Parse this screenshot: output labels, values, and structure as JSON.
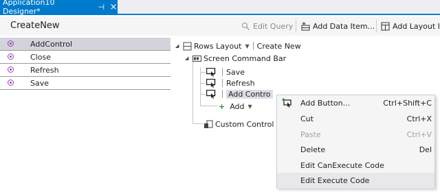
{
  "tab": {
    "title": "Application10 Designer*",
    "pin_glyph": "⊣",
    "close_glyph": "×"
  },
  "header": {
    "screen_name": "CreateNew",
    "edit_query": {
      "label": "Edit Query",
      "icon": "query-icon",
      "disabled": true
    },
    "add_data_item": {
      "label": "Add Data Item...",
      "icon": "add-data-item-icon"
    },
    "add_layout_item": {
      "label": "Add Layout Item",
      "icon": "add-layout-item-icon"
    }
  },
  "methods": [
    {
      "label": "AddControl",
      "selected": true
    },
    {
      "label": "Close",
      "selected": false
    },
    {
      "label": "Refresh",
      "selected": false
    },
    {
      "label": "Save",
      "selected": false
    }
  ],
  "tree": {
    "root_layout": "Rows Layout",
    "root_name": "Create New",
    "command_bar": "Screen Command Bar",
    "buttons": [
      "Save",
      "Refresh",
      "Add Contro"
    ],
    "add_label": "Add",
    "custom_control": "Custom Control"
  },
  "context_menu": [
    {
      "label": "Add Button...",
      "shortcut": "Ctrl+Shift+C",
      "disabled": false
    },
    {
      "label": "Cut",
      "shortcut": "Ctrl+X",
      "disabled": false
    },
    {
      "label": "Paste",
      "shortcut": "Ctrl+V",
      "disabled": true
    },
    {
      "label": "Delete",
      "shortcut": "Del",
      "disabled": false
    },
    {
      "label": "Edit CanExecute Code",
      "shortcut": "",
      "disabled": false
    },
    {
      "label": "Edit Execute Code",
      "shortcut": "",
      "disabled": false,
      "highlighted": true
    }
  ],
  "colors": {
    "accent": "#007acc",
    "method_icon": "#9b3fb5",
    "add_green": "#388a34"
  }
}
